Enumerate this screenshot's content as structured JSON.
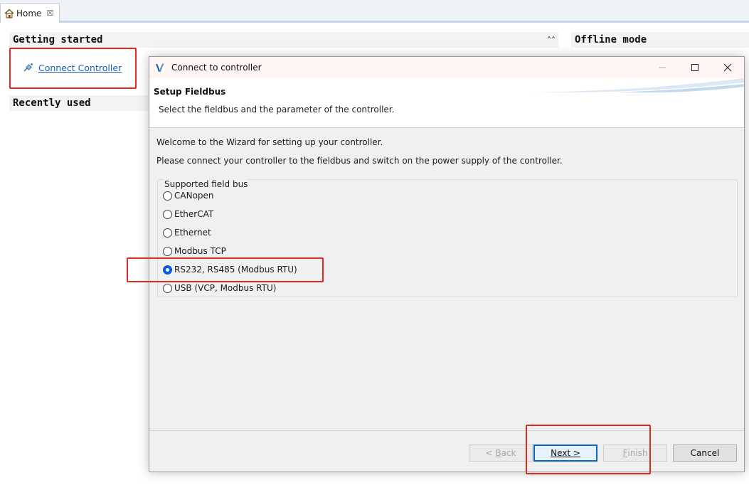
{
  "tabs": [
    {
      "label": "Home",
      "close": "☒"
    }
  ],
  "panels": {
    "getting_started": {
      "title": "Getting started",
      "collapse": "⌃⌃",
      "link": "Connect Controller"
    },
    "recently_used": {
      "title": "Recently used"
    },
    "offline_mode": {
      "title": "Offline mode"
    }
  },
  "dialog": {
    "title": "Connect to controller",
    "header_title": "Setup Fieldbus",
    "header_desc": "Select the fieldbus and the parameter of the controller.",
    "body_line1": "Welcome to the Wizard for setting up your controller.",
    "body_line2": "Please connect your controller to the fieldbus and switch on the power supply of the controller.",
    "group_label": "Supported field bus",
    "options": [
      {
        "label": "CANopen",
        "checked": false
      },
      {
        "label": "EtherCAT",
        "checked": false
      },
      {
        "label": "Ethernet",
        "checked": false
      },
      {
        "label": "Modbus TCP",
        "checked": false
      },
      {
        "label": "RS232, RS485 (Modbus RTU)",
        "checked": true
      },
      {
        "label": "USB (VCP, Modbus RTU)",
        "checked": false
      }
    ],
    "buttons": {
      "back_mnemonic": "< ",
      "back_u": "B",
      "back_rest": "ack",
      "next_u": "N",
      "next_rest": "ext >",
      "finish_u": "F",
      "finish_rest": "inish",
      "cancel": "Cancel"
    }
  },
  "colors": {
    "annotation": "#e02b20",
    "link": "#1a5fb4",
    "accent": "#0a5bd6"
  }
}
